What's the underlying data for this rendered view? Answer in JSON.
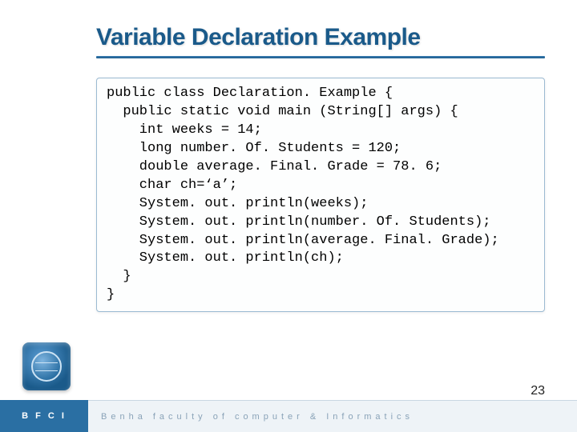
{
  "title": "Variable Declaration Example",
  "code": "public class Declaration. Example {\n  public static void main (String[] args) {\n    int weeks = 14;\n    long number. Of. Students = 120;\n    double average. Final. Grade = 78. 6;\n    char ch=‘a’;\n    System. out. println(weeks);\n    System. out. println(number. Of. Students);\n    System. out. println(average. Final. Grade);\n    System. out. println(ch);\n  }\n}",
  "page_number": "23",
  "footer_left": "B F C I",
  "footer_right": "Benha faculty of computer & Informatics"
}
